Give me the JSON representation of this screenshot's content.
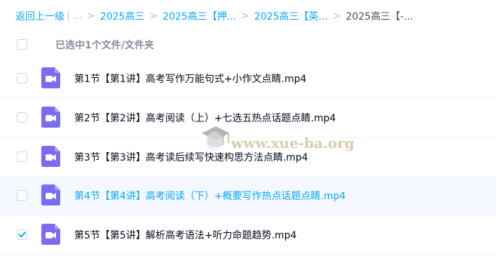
{
  "breadcrumb": {
    "back": "返回上一级",
    "ellipsis": "...",
    "items": [
      "2025高三",
      "2025高三【押...",
      "2025高三【英...",
      "2025高三【-..."
    ]
  },
  "selection": {
    "label": "已选中1个文件/文件夹"
  },
  "files": [
    {
      "name": "第1节【第1讲】高考写作万能句式+小作文点睛.mp4",
      "checked": false
    },
    {
      "name": "第2节【第2讲】高考阅读（上）+七选五热点话题点睛.mp4",
      "checked": false
    },
    {
      "name": "第3节【第3讲】高考读后续写快速构思方法点睛.mp4",
      "checked": false
    },
    {
      "name": "第4节【第4讲】高考阅读（下）+概要写作热点话题点睛.mp4",
      "checked": false
    },
    {
      "name": "第5节【第5讲】解析高考语法+听力命题趋势.mp4",
      "checked": true
    }
  ],
  "watermark": {
    "text": "www.xue-ba.org"
  },
  "colors": {
    "link": "#06a7ff",
    "video_icon": "#7b6bf0",
    "hover_bg": "#f5f9ff"
  },
  "icons": {
    "file_type": "video-file-icon",
    "check": "checkmark-icon"
  }
}
